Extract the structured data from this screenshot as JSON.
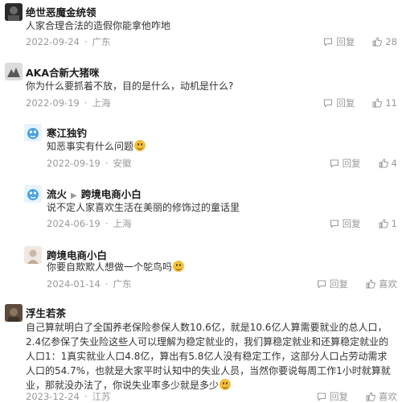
{
  "comments": [
    {
      "name": "绝世恶魔金统领",
      "text": "人家合理合法的造假你能拿他咋地",
      "date": "2022-09-24",
      "location": "广东",
      "reply_label": "回复",
      "likes": "28"
    },
    {
      "name": "AKA合新大猪咪",
      "text": "你为什么要抓着不放，目的是什么，动机是什么?",
      "date": "2022-09-19",
      "location": "上海",
      "reply_label": "回复",
      "likes": "11"
    },
    {
      "name": "寒江独钓",
      "text": "知恶事实有什么问题",
      "date": "2022-09-19",
      "location": "安徽",
      "reply_label": "回复",
      "likes": "4"
    },
    {
      "name": "流火",
      "reply_to": "跨境电商小白",
      "text": "说不定人家喜欢生活在美丽的修饰过的童话里",
      "date": "2024-06-19",
      "location": "上海",
      "reply_label": "回复",
      "likes": "1"
    },
    {
      "name": "跨境电商小白",
      "text": "你要自欺欺人想做一个鸵鸟吗",
      "date": "2024-01-14",
      "location": "广东",
      "reply_label": "回复",
      "likes": "喜欢"
    },
    {
      "name": "浮生若茶",
      "text": "自己算就明白了全国养老保险参保人数10.6亿，就是10.6亿人算需要就业的总人口，2.4亿参保了失业险这些人可以理解为稳定就业的，我们算稳定就业和还算稳定就业的人口1：1真实就业人口4.8亿，算出有5.8亿人没有稳定工作，这部分人口占劳动需求人口的54.7%，也就是大家平时认知中的失业人员，当然你要说每周工作1小时就算就业，那就没办法了，你说失业率多少就是多少",
      "date": "2023-12-24",
      "location": "江苏",
      "reply_label": "回复",
      "likes": "喜欢"
    }
  ],
  "icons": {
    "reply": "reply-bubble-icon",
    "like": "thumbs-up-icon",
    "reply_arrow": "triangle-right-icon"
  },
  "colors": {
    "name": "#1a1a1a",
    "meta": "#999999",
    "body": "#333333"
  }
}
